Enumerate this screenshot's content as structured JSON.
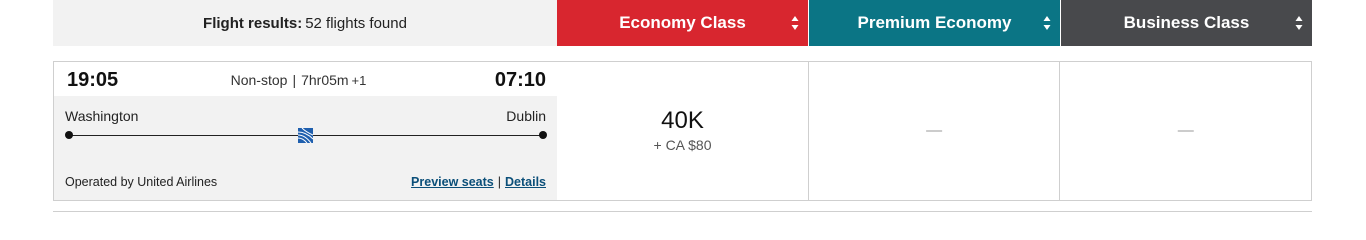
{
  "header": {
    "results_label": "Flight results:",
    "results_count": "52 flights found",
    "tabs": [
      {
        "label": "Economy Class",
        "color": "#d8262f"
      },
      {
        "label": "Premium Economy",
        "color": "#0b7585"
      },
      {
        "label": "Business Class",
        "color": "#48494c"
      }
    ]
  },
  "flight": {
    "departure_time": "19:05",
    "arrival_time": "07:10",
    "stops": "Non-stop",
    "separator": "|",
    "duration": "7hr05m",
    "day_offset": "+1",
    "origin": "Washington",
    "destination": "Dublin",
    "airline_icon": "united-airlines-globe-icon",
    "operated_by": "Operated by United Airlines",
    "preview_seats": "Preview seats",
    "link_separator": "|",
    "details": "Details",
    "fares": {
      "economy": {
        "points": "40K",
        "cash": "+ CA $80"
      },
      "premium": {
        "empty": "—"
      },
      "business": {
        "empty": "—"
      }
    }
  },
  "colors": {
    "economy": "#d8262f",
    "premium": "#0b7585",
    "business": "#48494c",
    "link": "#0b4f79",
    "header_bg": "#f2f2f2"
  }
}
